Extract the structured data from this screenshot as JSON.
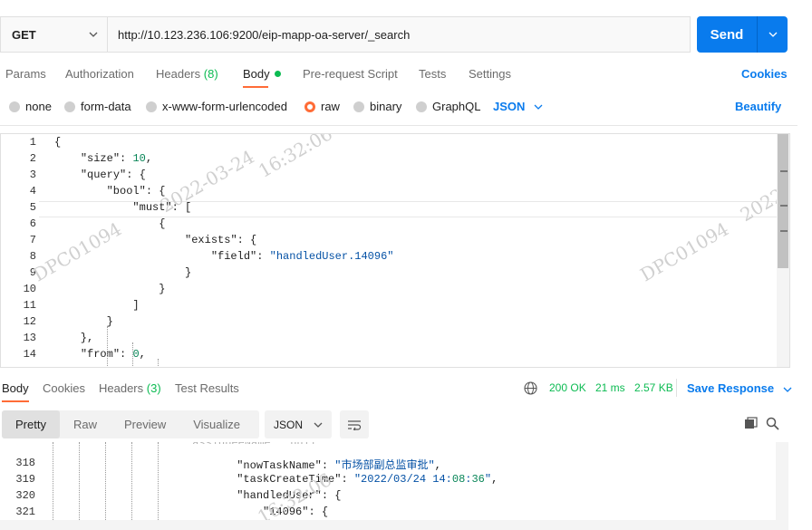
{
  "request": {
    "method": "GET",
    "url": "http://10.123.236.106:9200/eip-mapp-oa-server/_search",
    "send_label": "Send"
  },
  "tabs": {
    "params": "Params",
    "authorization": "Authorization",
    "headers": "Headers",
    "headers_count": "(8)",
    "body": "Body",
    "prerequest": "Pre-request Script",
    "tests": "Tests",
    "settings": "Settings",
    "cookies": "Cookies"
  },
  "body_types": {
    "none": "none",
    "form_data": "form-data",
    "urlencoded": "x-www-form-urlencoded",
    "raw": "raw",
    "binary": "binary",
    "graphql": "GraphQL",
    "format": "JSON",
    "beautify": "Beautify"
  },
  "request_lines": [
    {
      "n": "1",
      "t": "{"
    },
    {
      "n": "2",
      "t": "    \"size\": 10,"
    },
    {
      "n": "3",
      "t": "    \"query\": {"
    },
    {
      "n": "4",
      "t": "        \"bool\": {"
    },
    {
      "n": "5",
      "t": "            \"must\": ["
    },
    {
      "n": "6",
      "t": "                {"
    },
    {
      "n": "7",
      "t": "                    \"exists\": {"
    },
    {
      "n": "8",
      "t": "                        \"field\": \"handledUser.14096\""
    },
    {
      "n": "9",
      "t": "                    }"
    },
    {
      "n": "10",
      "t": "                }"
    },
    {
      "n": "11",
      "t": "            ]"
    },
    {
      "n": "12",
      "t": "        }"
    },
    {
      "n": "13",
      "t": "    },"
    },
    {
      "n": "14",
      "t": "    \"from\": 0,"
    }
  ],
  "response_tabs": {
    "body": "Body",
    "cookies": "Cookies",
    "headers": "Headers",
    "headers_count": "(3)",
    "test_results": "Test Results"
  },
  "response_meta": {
    "status": "200 OK",
    "time": "21 ms",
    "size": "2.57 KB",
    "save": "Save Response"
  },
  "view_modes": {
    "pretty": "Pretty",
    "raw": "Raw",
    "preview": "Preview",
    "visualize": "Visualize",
    "format": "JSON"
  },
  "response_lines": [
    {
      "n": "318",
      "t": "                \"nowTaskName\": \"市场部副总监审批\","
    },
    {
      "n": "319",
      "t": "                \"taskCreateTime\": \"2022/03/24 14:08:36\","
    },
    {
      "n": "320",
      "t": "                \"handledUser\": {"
    },
    {
      "n": "321",
      "t": "                    \"14096\": {"
    }
  ],
  "watermarks": [
    "16:32:06",
    "2022-03-24",
    "DPC01094",
    "DPC01094",
    "2022-03",
    "16:32:06"
  ],
  "colors": {
    "accent": "#097bed",
    "active_tab": "#ff6c37",
    "status_ok": "#0cbb52"
  }
}
